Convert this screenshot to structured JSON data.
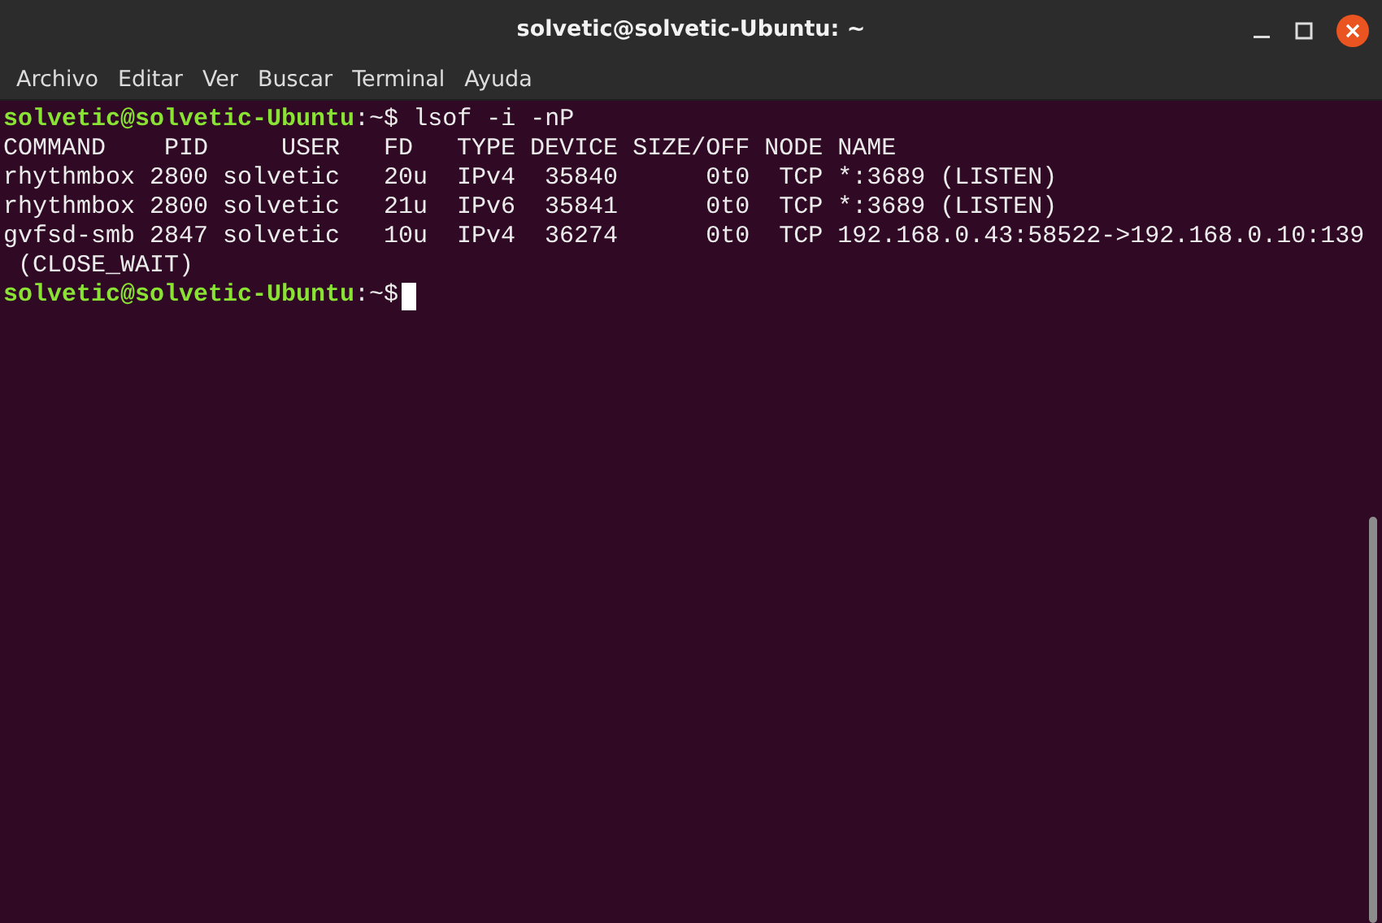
{
  "window": {
    "title": "solvetic@solvetic-Ubuntu: ~"
  },
  "menu": [
    "Archivo",
    "Editar",
    "Ver",
    "Buscar",
    "Terminal",
    "Ayuda"
  ],
  "terminal": {
    "lines": [
      {
        "kind": "prompt",
        "user_host": "solvetic@solvetic-Ubuntu",
        "path": ":~$",
        "command": " lsof -i -nP",
        "cursor": false
      },
      {
        "kind": "output",
        "text": "COMMAND    PID     USER   FD   TYPE DEVICE SIZE/OFF NODE NAME"
      },
      {
        "kind": "output",
        "text": "rhythmbox 2800 solvetic   20u  IPv4  35840      0t0  TCP *:3689 (LISTEN)"
      },
      {
        "kind": "output",
        "text": "rhythmbox 2800 solvetic   21u  IPv6  35841      0t0  TCP *:3689 (LISTEN)"
      },
      {
        "kind": "output",
        "text": "gvfsd-smb 2847 solvetic   10u  IPv4  36274      0t0  TCP 192.168.0.43:58522->192.168.0.10:139"
      },
      {
        "kind": "output",
        "text": " (CLOSE_WAIT)"
      },
      {
        "kind": "prompt",
        "user_host": "solvetic@solvetic-Ubuntu",
        "path": ":~$",
        "cursor": true
      }
    ]
  }
}
